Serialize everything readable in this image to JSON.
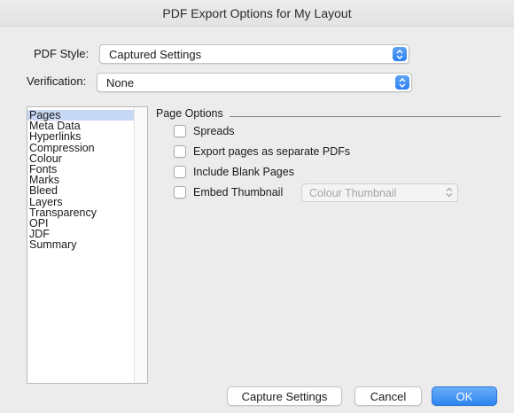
{
  "window": {
    "title": "PDF Export Options for My Layout"
  },
  "pdf_style": {
    "label": "PDF Style:",
    "value": "Captured Settings"
  },
  "verification": {
    "label": "Verification:",
    "value": "None"
  },
  "sidebar": {
    "items": [
      {
        "label": "Pages",
        "selected": true
      },
      {
        "label": "Meta Data"
      },
      {
        "label": "Hyperlinks"
      },
      {
        "label": "Compression"
      },
      {
        "label": "Colour"
      },
      {
        "label": "Fonts"
      },
      {
        "label": "Marks"
      },
      {
        "label": "Bleed"
      },
      {
        "label": "Layers"
      },
      {
        "label": "Transparency"
      },
      {
        "label": "OPI"
      },
      {
        "label": "JDF"
      },
      {
        "label": "Summary"
      }
    ]
  },
  "page_options": {
    "title": "Page Options",
    "spreads": {
      "label": "Spreads",
      "checked": false
    },
    "separate_pdfs": {
      "label": "Export pages as separate PDFs",
      "checked": false
    },
    "blank_pages": {
      "label": "Include Blank Pages",
      "checked": false
    },
    "thumbnail": {
      "label": "Embed Thumbnail",
      "checked": false,
      "option": "Colour Thumbnail"
    }
  },
  "buttons": {
    "capture": "Capture Settings",
    "cancel": "Cancel",
    "ok": "OK"
  },
  "colors": {
    "accent": "#2c84f1",
    "selection": "#c7d8f4",
    "window_bg": "#ececec"
  }
}
